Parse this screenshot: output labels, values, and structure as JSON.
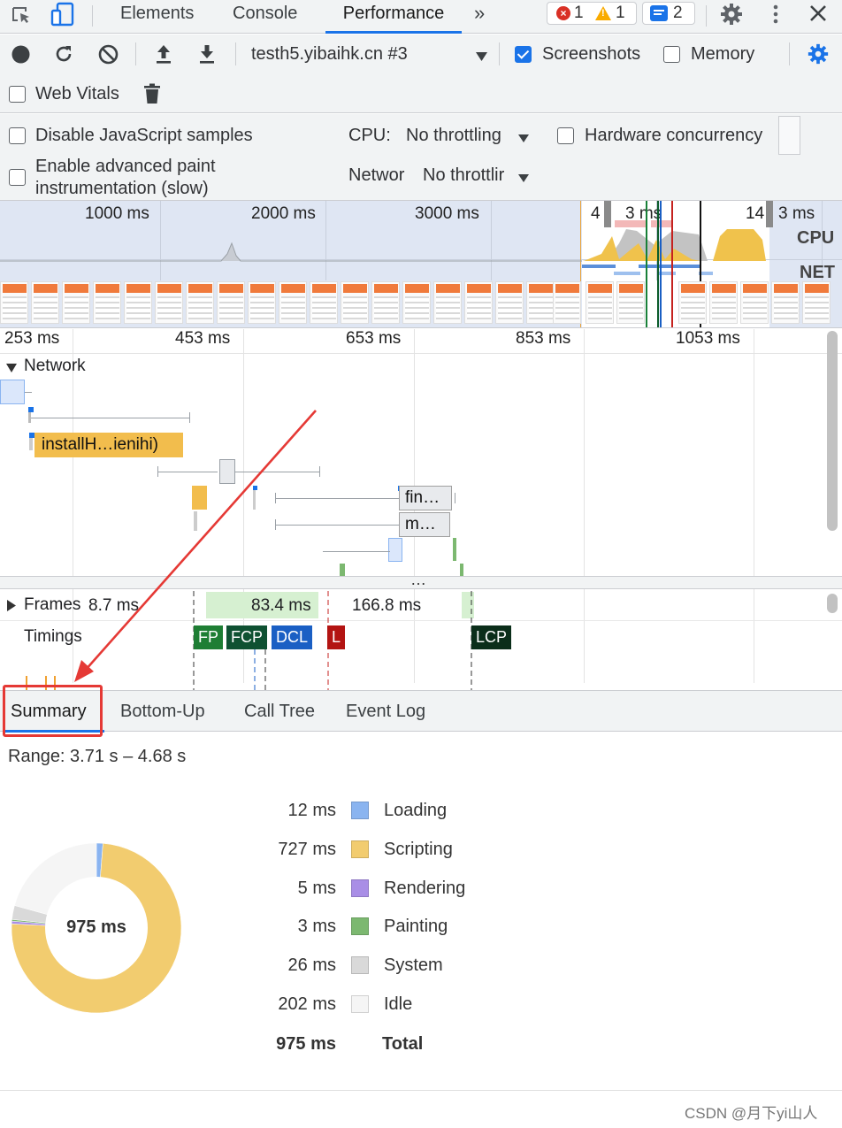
{
  "top_tabs": [
    "Elements",
    "Console",
    "Performance"
  ],
  "more_tabs_glyph": "»",
  "badges": {
    "errors": "1",
    "warnings": "1",
    "messages": "2"
  },
  "toolbar": {
    "url": "testh5.yibaihk.cn #3",
    "screenshots_label": "Screenshots",
    "screenshots_checked": true,
    "memory_label": "Memory",
    "web_vitals_label": "Web Vitals"
  },
  "settings": {
    "disable_js_samples": "Disable JavaScript samples",
    "advanced_paint_line1": "Enable advanced paint",
    "advanced_paint_line2": "instrumentation (slow)",
    "cpu_label": "CPU:",
    "cpu_value": "No throttling",
    "network_label": "Networ",
    "network_value": "No throttlir",
    "hw_concurrency": "Hardware concurrency"
  },
  "overview": {
    "ticks": [
      "1000 ms",
      "2000 ms",
      "3000 ms",
      "4",
      "3 ms",
      "14",
      "3 ms"
    ],
    "cpu_label": "CPU",
    "net_label": "NET"
  },
  "timeline": {
    "ruler": [
      "253 ms",
      "453 ms",
      "653 ms",
      "853 ms",
      "1053 ms"
    ],
    "network_label": "Network",
    "net_items": [
      "installH…ienihi)",
      "fin…",
      "m…"
    ],
    "frames_label": "Frames",
    "frame_times": [
      "8.7 ms",
      "83.4 ms",
      "166.8 ms"
    ],
    "timings_label": "Timings",
    "timings": [
      {
        "label": "FP",
        "color": "#1e7e34"
      },
      {
        "label": "FCP",
        "color": "#0f5132"
      },
      {
        "label": "DCL",
        "color": "#1a5fc4"
      },
      {
        "label": "L",
        "color": "#c5221f"
      },
      {
        "label": "LCP",
        "color": "#0b2e1a"
      }
    ]
  },
  "bottom_tabs": [
    "Summary",
    "Bottom-Up",
    "Call Tree",
    "Event Log"
  ],
  "summary": {
    "range": "Range: 3.71 s – 4.68 s",
    "total_center": "975 ms",
    "rows": [
      {
        "value": "12 ms",
        "label": "Loading",
        "color": "#8ab4f0",
        "ms": 12
      },
      {
        "value": "727 ms",
        "label": "Scripting",
        "color": "#f2cc6f",
        "ms": 727
      },
      {
        "value": "5 ms",
        "label": "Rendering",
        "color": "#a98ee6",
        "ms": 5
      },
      {
        "value": "3 ms",
        "label": "Painting",
        "color": "#7cb870",
        "ms": 3
      },
      {
        "value": "26 ms",
        "label": "System",
        "color": "#d9d9d9",
        "ms": 26
      },
      {
        "value": "202 ms",
        "label": "Idle",
        "color": "#f5f5f5",
        "ms": 202
      }
    ],
    "total_value": "975 ms",
    "total_label": "Total"
  },
  "watermark": "CSDN @月下yi山人",
  "annotation_color": "#e53935"
}
